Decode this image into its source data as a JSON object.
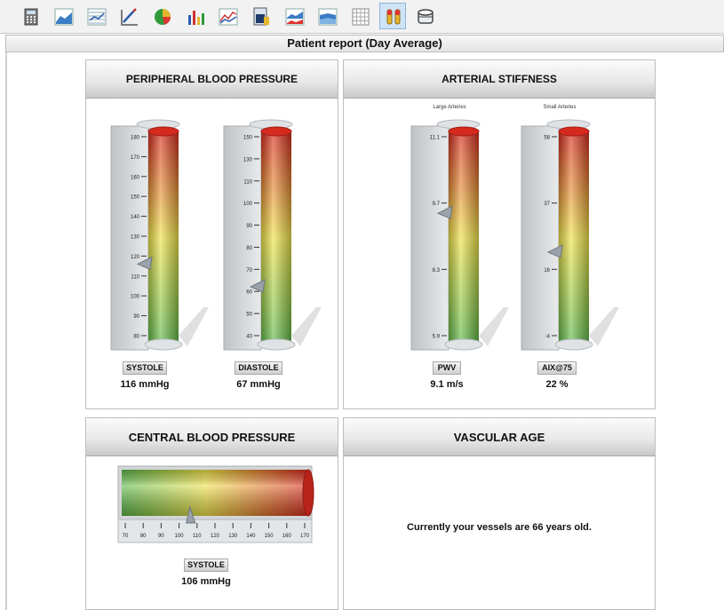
{
  "toolbar": {
    "buttons": [
      {
        "icon": "calculator-icon"
      },
      {
        "icon": "area-chart-icon"
      },
      {
        "icon": "grid-chart-icon"
      },
      {
        "icon": "line-edit-chart-icon"
      },
      {
        "icon": "pie-chart-icon"
      },
      {
        "icon": "bar-chart-icon"
      },
      {
        "icon": "trend-chart-icon"
      },
      {
        "icon": "report-document-icon"
      },
      {
        "icon": "dual-area-chart-icon"
      },
      {
        "icon": "stacked-area-chart-icon"
      },
      {
        "icon": "table-grid-icon"
      },
      {
        "icon": "gauge-columns-icon",
        "active": true
      },
      {
        "icon": "database-icon"
      }
    ]
  },
  "report": {
    "title": "Patient report (Day Average)"
  },
  "panels": {
    "peripheral": {
      "title": "PERIPHERAL BLOOD PRESSURE",
      "gauges": [
        {
          "label": "SYSTOLE",
          "reading": "116 mmHg",
          "value": 116,
          "min": 80,
          "max": 180,
          "ticks": [
            "180",
            "170",
            "160",
            "150",
            "140",
            "130",
            "120",
            "110",
            "100",
            "90",
            "80"
          ]
        },
        {
          "label": "DIASTOLE",
          "reading": "67 mmHg",
          "value": 67,
          "min": 40,
          "max": 150,
          "ticks": [
            "150",
            "130",
            "110",
            "100",
            "90",
            "80",
            "70",
            "60",
            "50",
            "40"
          ]
        }
      ]
    },
    "stiffness": {
      "title": "ARTERIAL STIFFNESS",
      "gauges": [
        {
          "caption": "Large Arteries",
          "label": "PWV",
          "reading": "9.1 m/s",
          "value": 9.1,
          "min": 5.9,
          "max": 11.1,
          "ticks": [
            "11.1",
            "9.7",
            "8.3",
            "5.9"
          ]
        },
        {
          "caption": "Small Arteries",
          "label": "AIX@75",
          "reading": "22 %",
          "value": 22,
          "min": -4,
          "max": 58,
          "ticks": [
            "58",
            "37",
            "16",
            "-4"
          ]
        }
      ]
    },
    "central": {
      "title": "CENTRAL BLOOD PRESSURE",
      "label": "SYSTOLE",
      "reading": "106 mmHg",
      "value": 106,
      "min": 70,
      "max": 170,
      "ticks": [
        "70",
        "80",
        "90",
        "100",
        "110",
        "120",
        "130",
        "140",
        "150",
        "160",
        "170"
      ]
    },
    "vascular": {
      "title": "VASCULAR AGE",
      "message": "Currently your vessels are 66 years old."
    }
  },
  "colors": {
    "gauge_top": "#d62a1e",
    "gauge_mid": "#efe24a",
    "gauge_bottom": "#5db84a",
    "pointer": "#9aa3ab",
    "active_button": "#cfe3f7"
  }
}
